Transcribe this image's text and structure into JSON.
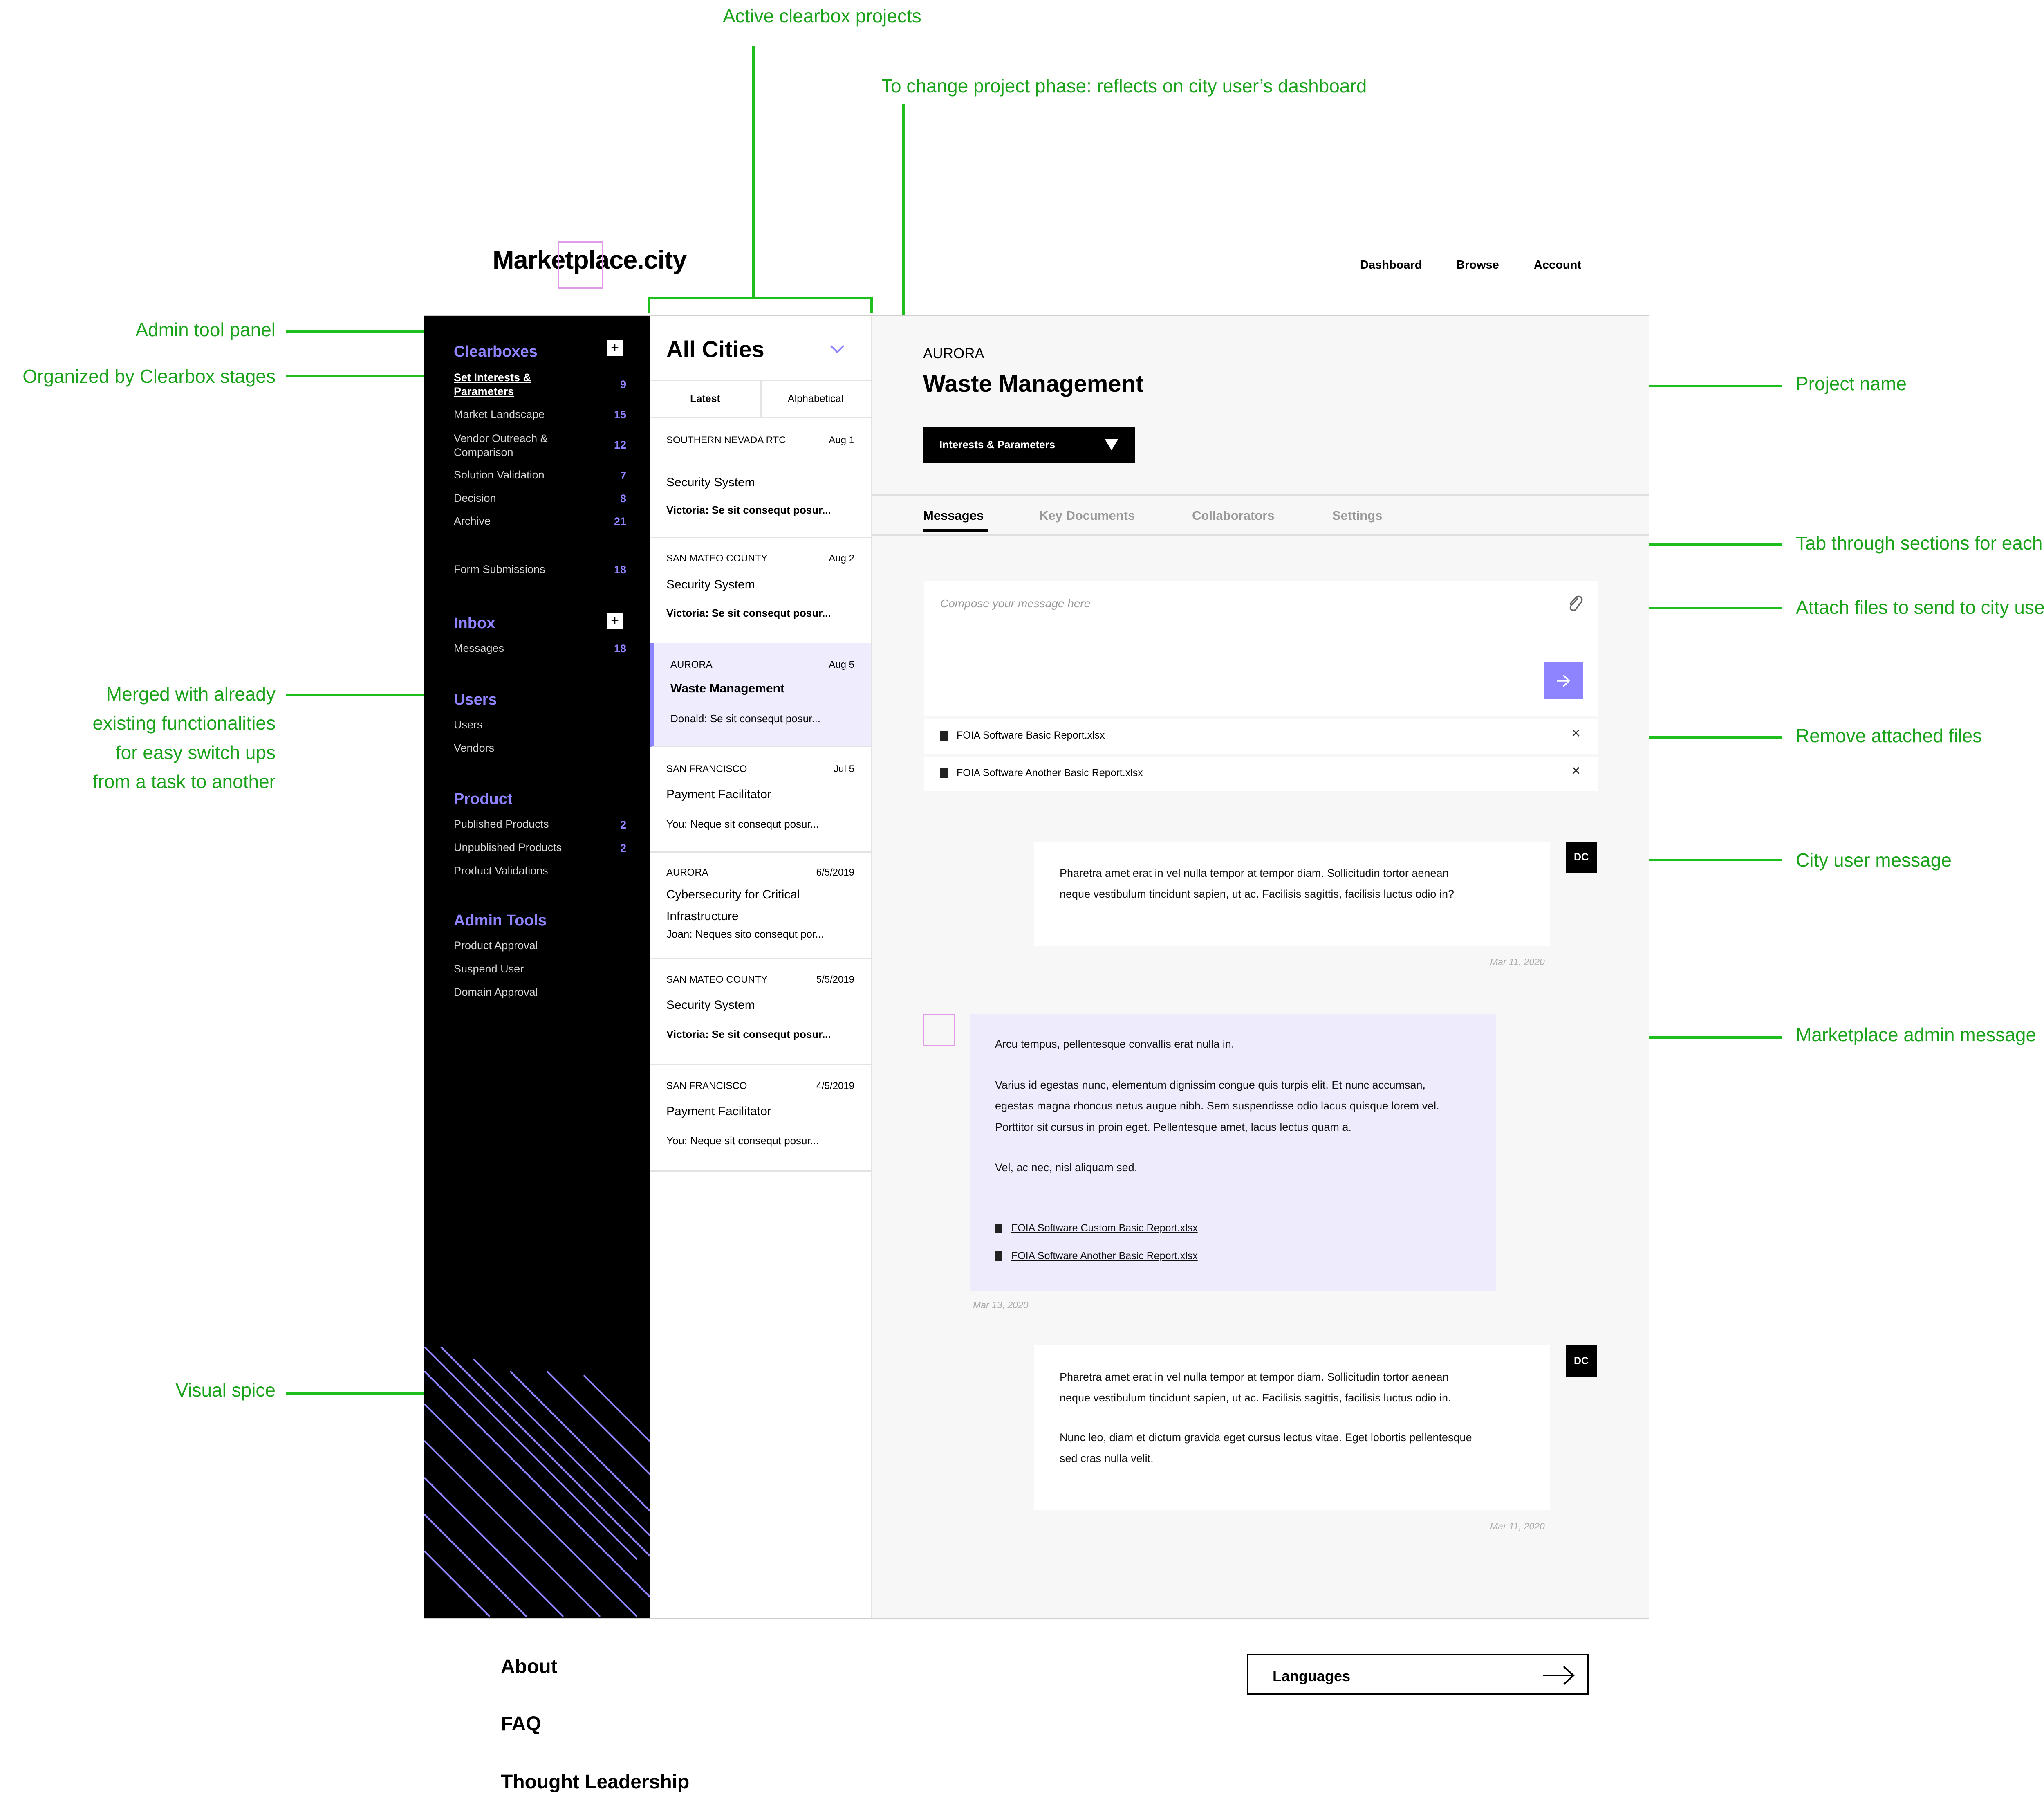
{
  "annotations": {
    "active_projects": "Active clearbox projects",
    "change_phase": "To change project phase: reflects on city user’s dashboard",
    "admin_panel": "Admin tool panel",
    "organized": "Organized by Clearbox stages",
    "merged": [
      "Merged with already",
      "existing functionalities",
      "for easy switch ups",
      "from a task to another"
    ],
    "visual_spice": "Visual spice",
    "project_name": "Project name",
    "tab_through": "Tab through sections for each project",
    "attach_files": "Attach files to send to city users",
    "remove_files": "Remove attached files",
    "city_user_msg": "City user message",
    "admin_msg": "Marketplace admin message"
  },
  "header": {
    "logo": "Marketplace.city",
    "nav": [
      "Dashboard",
      "Browse",
      "Account"
    ]
  },
  "sidebar": {
    "clearboxes": {
      "title": "Clearboxes",
      "items": [
        {
          "label": "Set Interests &\nParameters",
          "count": "9"
        },
        {
          "label": "Market Landscape",
          "count": "15"
        },
        {
          "label": "Vendor Outreach &\nComparison",
          "count": "12"
        },
        {
          "label": "Solution Validation",
          "count": "7"
        },
        {
          "label": "Decision",
          "count": "8"
        },
        {
          "label": "Archive",
          "count": "21"
        }
      ],
      "form": {
        "label": "Form Submissions",
        "count": "18"
      }
    },
    "inbox": {
      "title": "Inbox",
      "items": [
        {
          "label": "Messages",
          "count": "18"
        }
      ]
    },
    "users": {
      "title": "Users",
      "items": [
        "Users",
        "Vendors"
      ]
    },
    "product": {
      "title": "Product",
      "items": [
        {
          "label": "Published Products",
          "count": "2"
        },
        {
          "label": "Unpublished Products",
          "count": "2"
        },
        {
          "label": "Product Validations",
          "count": ""
        }
      ]
    },
    "admin_tools": {
      "title": "Admin Tools",
      "items": [
        "Product Approval",
        "Suspend User",
        "Domain Approval"
      ]
    }
  },
  "list": {
    "filter": "All Cities",
    "sort_tabs": [
      "Latest",
      "Alphabetical"
    ],
    "items": [
      {
        "city": "SOUTHERN NEVADA RTC",
        "date": "Aug 1",
        "title": "Security System",
        "snippet": "Victoria: Se sit consequt posur..."
      },
      {
        "city": "SAN MATEO COUNTY",
        "date": "Aug 2",
        "title": "Security System",
        "snippet": "Victoria: Se sit consequt posur..."
      },
      {
        "city": "AURORA",
        "date": "Aug 5",
        "title": "Waste Management",
        "snippet": "Donald: Se sit consequt posur..."
      },
      {
        "city": "SAN FRANCISCO",
        "date": "Jul 5",
        "title": "Payment Facilitator",
        "snippet": "You: Neque sit consequt posur..."
      },
      {
        "city": "AURORA",
        "date": "6/5/2019",
        "title": "Cybersecurity for Critical\nInfrastructure",
        "snippet": "Joan: Neques sito consequt por..."
      },
      {
        "city": "SAN MATEO COUNTY",
        "date": "5/5/2019",
        "title": "Security System",
        "snippet": "Victoria: Se sit consequt posur..."
      },
      {
        "city": "SAN FRANCISCO",
        "date": "4/5/2019",
        "title": "Payment Facilitator",
        "snippet": "You: Neque sit consequt posur..."
      }
    ]
  },
  "project": {
    "city": "AURORA",
    "name": "Waste Management",
    "phase": "Interests & Parameters",
    "tabs": [
      "Messages",
      "Key Documents",
      "Collaborators",
      "Settings"
    ],
    "compose_placeholder": "Compose your message here",
    "attachments": [
      "FOIA Software Basic Report.xlsx",
      "FOIA Software Another Basic Report.xlsx"
    ],
    "messages": [
      {
        "avatar": "DC",
        "paragraphs": [
          "Pharetra amet erat in vel nulla tempor at tempor diam. Sollicitudin tortor aenean\nneque vestibulum tincidunt sapien, ut ac. Facilisis sagittis, facilisis luctus odio in?"
        ],
        "time": "Mar 11, 2020"
      },
      {
        "paragraphs": [
          "Arcu tempus, pellentesque convallis erat nulla in.",
          "Varius id egestas nunc, elementum dignissim congue quis turpis elit. Et nunc accumsan,\negestas magna rhoncus netus augue nibh. Sem suspendisse odio lacus quisque lorem vel.\nPorttitor sit cursus in proin eget. Pellentesque amet, lacus lectus quam a.",
          "Vel, ac nec, nisl aliquam sed."
        ],
        "files": [
          "FOIA Software Custom Basic Report.xlsx",
          "FOIA Software Another Basic Report.xlsx"
        ],
        "time": "Mar 13, 2020"
      },
      {
        "avatar": "DC",
        "paragraphs": [
          "Pharetra amet erat in vel nulla tempor at tempor diam. Sollicitudin tortor aenean\nneque vestibulum tincidunt sapien, ut ac. Facilisis sagittis, facilisis luctus odio in.",
          "Nunc leo, diam et dictum gravida eget cursus lectus vitae. Eget lobortis pellentesque\nsed cras nulla velit."
        ],
        "time": "Mar 11, 2020"
      }
    ]
  },
  "footer": {
    "links": [
      "About",
      "FAQ",
      "Thought Leadership"
    ],
    "languages": "Languages"
  },
  "colors": {
    "accent": "#8f84ff",
    "annotation": "#1aa31a",
    "admin_bg": "#eeebfc"
  }
}
